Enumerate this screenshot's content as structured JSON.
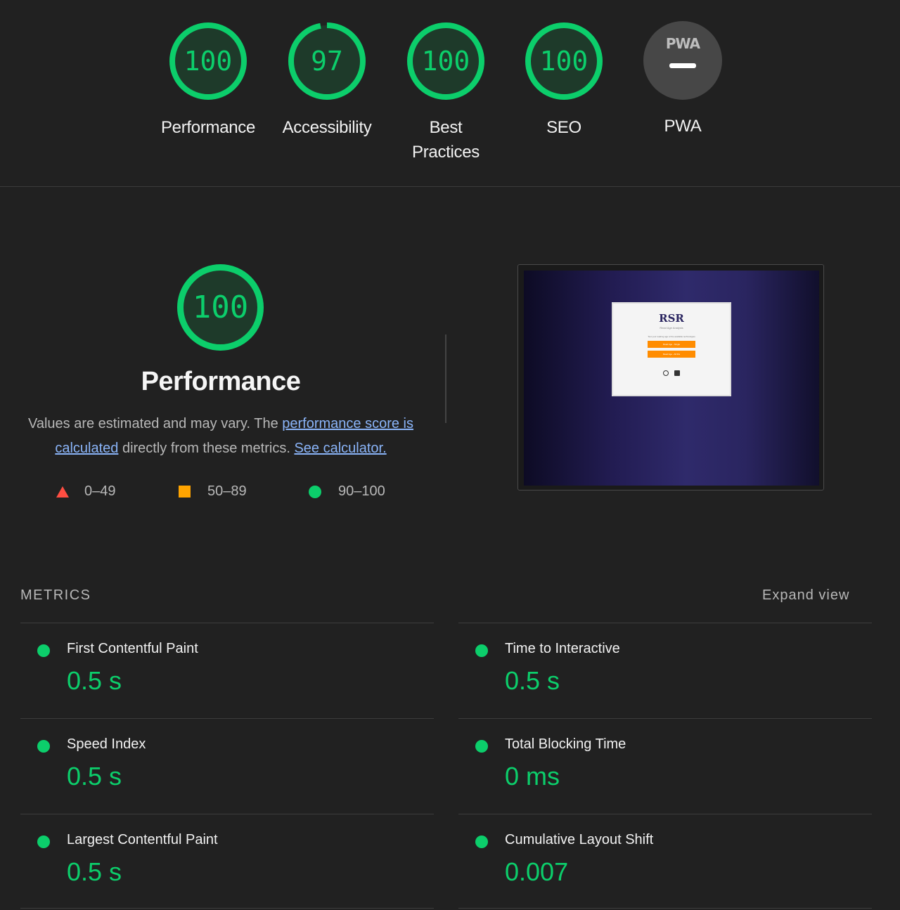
{
  "summary": {
    "gauges": [
      {
        "score": "100",
        "label": "Performance",
        "fraction": 1.0
      },
      {
        "score": "97",
        "label": "Accessibility",
        "fraction": 0.97
      },
      {
        "score": "100",
        "label": "Best Practices",
        "label_line1": "Best",
        "label_line2": "Practices",
        "fraction": 1.0
      },
      {
        "score": "100",
        "label": "SEO",
        "fraction": 1.0
      }
    ],
    "pwa": {
      "badge": "PWA",
      "label": "PWA"
    }
  },
  "performance": {
    "score": "100",
    "fraction": 1.0,
    "title": "Performance",
    "desc_1": "Values are estimated and may vary. The ",
    "link_score": "performance score is calculated",
    "desc_2": " directly from these metrics. ",
    "link_calc": "See calculator.",
    "legend": [
      "0–49",
      "50–89",
      "90–100"
    ]
  },
  "screenshot": {
    "title": "RSR",
    "subtitle": "Read Age Analysis",
    "tagline": "Text your reading age of the available technologies",
    "button_1": "Read Age - Single",
    "button_2": "Read Age - All IDs"
  },
  "metrics": {
    "heading": "METRICS",
    "expand": "Expand view",
    "items": [
      {
        "name": "First Contentful Paint",
        "value": "0.5 s"
      },
      {
        "name": "Time to Interactive",
        "value": "0.5 s"
      },
      {
        "name": "Speed Index",
        "value": "0.5 s"
      },
      {
        "name": "Total Blocking Time",
        "value": "0 ms"
      },
      {
        "name": "Largest Contentful Paint",
        "value": "0.5 s"
      },
      {
        "name": "Cumulative Layout Shift",
        "value": "0.007"
      }
    ]
  },
  "colors": {
    "pass": "#0cce6b",
    "average": "#ffa400",
    "fail": "#ff4e42",
    "background": "#212121"
  }
}
